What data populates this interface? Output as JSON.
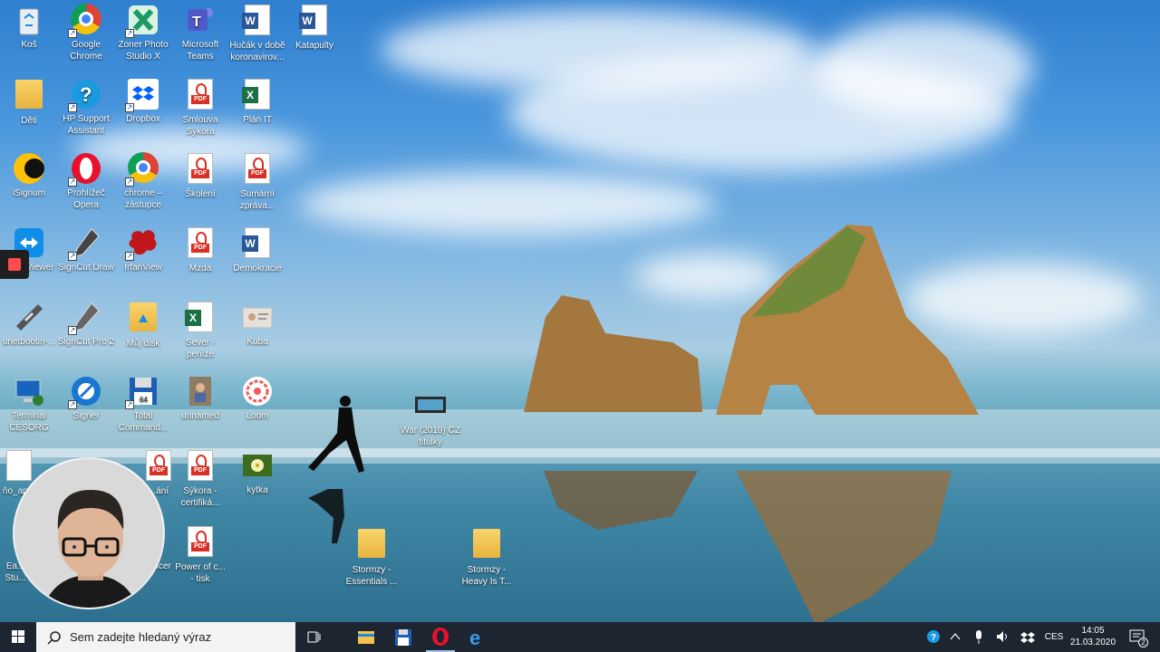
{
  "desktop": {
    "icons": [
      {
        "label": "Koš",
        "icon": "recycle-bin-icon"
      },
      {
        "label": "Google\nChrome",
        "icon": "chrome-icon"
      },
      {
        "label": "Zoner Photo\nStudio X",
        "icon": "zoner-photo-icon"
      },
      {
        "label": "Microsoft\nTeams",
        "icon": "teams-icon"
      },
      {
        "label": "Hučák v době\nkoronavirov...",
        "icon": "word-document-icon"
      },
      {
        "label": "Katapulty",
        "icon": "word-document-icon"
      },
      {
        "label": "Děti",
        "icon": "folder-icon"
      },
      {
        "label": "HP Support\nAssistant",
        "icon": "help-icon"
      },
      {
        "label": "Dropbox",
        "icon": "dropbox-icon"
      },
      {
        "label": "Smlouva\nSýkora",
        "icon": "pdf-icon"
      },
      {
        "label": "Plán IT",
        "icon": "excel-icon"
      },
      {
        "label": "iSignum",
        "icon": "isignum-icon"
      },
      {
        "label": "Prohlížeč\nOpera",
        "icon": "opera-icon"
      },
      {
        "label": "chrome –\nzástupce",
        "icon": "chrome-icon"
      },
      {
        "label": "Školení",
        "icon": "pdf-icon"
      },
      {
        "label": "Sumární\nzpráva...",
        "icon": "pdf-icon"
      },
      {
        "label": "TeamViewer",
        "icon": "teamviewer-icon"
      },
      {
        "label": "SignCut Draw",
        "icon": "pen-icon"
      },
      {
        "label": "IrfanView",
        "icon": "irfanview-icon"
      },
      {
        "label": "Mzda",
        "icon": "pdf-icon"
      },
      {
        "label": "Demokracie",
        "icon": "word-document-icon"
      },
      {
        "label": "unetbootin-...",
        "icon": "unetbootin-icon"
      },
      {
        "label": "SignCut Pro 2",
        "icon": "pen-icon"
      },
      {
        "label": "Můj disk",
        "icon": "drive-folder-icon"
      },
      {
        "label": "Sever -\npeníze",
        "icon": "excel-icon"
      },
      {
        "label": "Kuba",
        "icon": "image-icon"
      },
      {
        "label": "Terminal\nCESORG",
        "icon": "terminal-icon"
      },
      {
        "label": "Signer",
        "icon": "signer-icon"
      },
      {
        "label": "Total\nCommand...",
        "icon": "floppy-icon"
      },
      {
        "label": "unnamed",
        "icon": "image-icon"
      },
      {
        "label": "Loom",
        "icon": "loom-icon"
      },
      {
        "label": "War (2019) CZ\ntitulky",
        "icon": "video-icon"
      },
      {
        "label": "ňo_ap...",
        "icon": "file-icon"
      },
      {
        "label": "...ání",
        "icon": "pdf-icon"
      },
      {
        "label": "Sýkora -\ncertifiká...",
        "icon": "pdf-icon"
      },
      {
        "label": "kytka",
        "icon": "image-icon"
      },
      {
        "label": "Ea...\nStu...",
        "icon": "app-icon"
      },
      {
        "label": "...ncer",
        "icon": "app-icon"
      },
      {
        "label": "Power of c...\n- tisk",
        "icon": "pdf-icon"
      },
      {
        "label": "Stormzy -\nEssentials ...",
        "icon": "folder-icon"
      },
      {
        "label": "Stormzy -\nHeavy Is T...",
        "icon": "folder-icon"
      }
    ]
  },
  "taskbar": {
    "search_placeholder": "Sem zadejte hledaný výraz",
    "language": "CES",
    "time": "14:05",
    "date": "21.03.2020",
    "notification_count": "2"
  },
  "colors": {
    "taskbar_bg": "#1c2530",
    "pdf_red": "#d93025",
    "word_blue": "#2b5797",
    "excel_green": "#1d7045"
  }
}
